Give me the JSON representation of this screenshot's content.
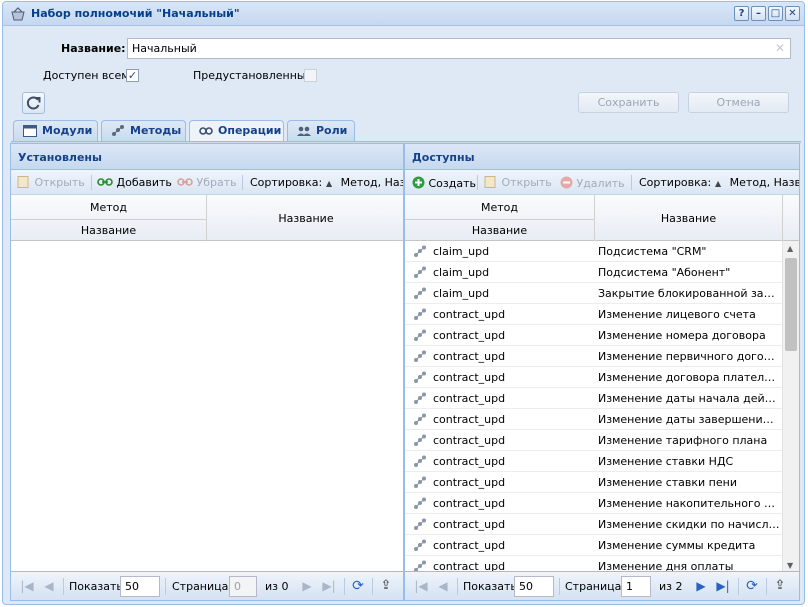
{
  "window": {
    "title": "Набор полномочий \"Начальный\"",
    "buttons": [
      "?",
      "–",
      "□",
      "✕"
    ]
  },
  "form": {
    "name_label": "Название:",
    "name_value": "Начальный",
    "available_label": "Доступен всем:",
    "available_checked": true,
    "preset_label": "Предустановленный:",
    "preset_checked": false,
    "save_label": "Сохранить",
    "cancel_label": "Отмена"
  },
  "tabs": [
    {
      "label": "Модули",
      "icon": "module-icon",
      "active": false
    },
    {
      "label": "Методы",
      "icon": "methods-icon",
      "active": false
    },
    {
      "label": "Операции",
      "icon": "operations-icon",
      "active": true
    },
    {
      "label": "Роли",
      "icon": "roles-icon",
      "active": false
    }
  ],
  "installed": {
    "title": "Установлены",
    "toolbar": {
      "open": "Открыть",
      "add": "Добавить",
      "remove": "Убрать",
      "sort_label": "Сортировка:",
      "sort_value": "Метод, Назв"
    },
    "columns": {
      "method": "Метод",
      "name_sub": "Название",
      "name": "Название"
    },
    "pager": {
      "show_label": "Показать",
      "show_value": "50",
      "page_label": "Страница",
      "page_value": "0",
      "of_label": "из 0"
    }
  },
  "available": {
    "title": "Доступны",
    "toolbar": {
      "create": "Создать",
      "open": "Открыть",
      "delete": "Удалить",
      "sort_label": "Сортировка:",
      "sort_value": "Метод, Назва"
    },
    "columns": {
      "method": "Метод",
      "name_sub": "Название",
      "name": "Название"
    },
    "rows": [
      {
        "method": "claim_upd",
        "name": "Подсистема \"CRM\""
      },
      {
        "method": "claim_upd",
        "name": "Подсистема \"Абонент\""
      },
      {
        "method": "claim_upd",
        "name": "Закрытие блокированной заявки"
      },
      {
        "method": "contract_upd",
        "name": "Изменение лицевого счета"
      },
      {
        "method": "contract_upd",
        "name": "Изменение номера договора"
      },
      {
        "method": "contract_upd",
        "name": "Изменение первичного договора"
      },
      {
        "method": "contract_upd",
        "name": "Изменение договора плательщика"
      },
      {
        "method": "contract_upd",
        "name": "Изменение даты начала действия"
      },
      {
        "method": "contract_upd",
        "name": "Изменение даты завершения де..."
      },
      {
        "method": "contract_upd",
        "name": "Изменение тарифного плана"
      },
      {
        "method": "contract_upd",
        "name": "Изменение ставки НДС"
      },
      {
        "method": "contract_upd",
        "name": "Изменение ставки пени"
      },
      {
        "method": "contract_upd",
        "name": "Изменение накопительного лим..."
      },
      {
        "method": "contract_upd",
        "name": "Изменение скидки по начислени..."
      },
      {
        "method": "contract_upd",
        "name": "Изменение суммы кредита"
      },
      {
        "method": "contract_upd",
        "name": "Изменение дня оплаты"
      }
    ],
    "pager": {
      "show_label": "Показать",
      "show_value": "50",
      "page_label": "Страница",
      "page_value": "1",
      "of_label": "из 2"
    }
  }
}
